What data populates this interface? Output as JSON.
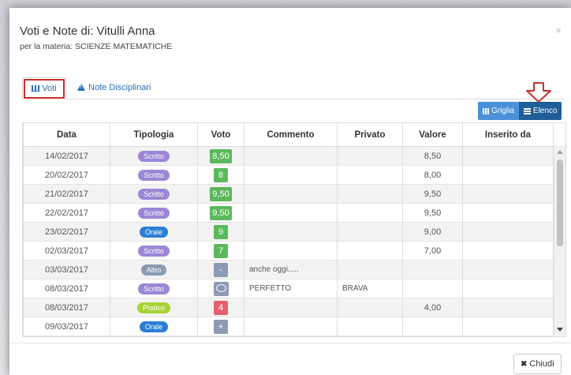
{
  "modal": {
    "title": "Voti e Note di: Vitulli Anna",
    "subtitle": "per la materia: SCIENZE MATEMATICHE",
    "close_symbol": "×"
  },
  "tabs": [
    {
      "label": "Voti",
      "icon": "bar-chart-icon",
      "active": true
    },
    {
      "label": "Note Disciplinari",
      "icon": "warning-icon",
      "active": false
    }
  ],
  "view_buttons": {
    "griglia": "Griglia",
    "elenco": "Elenco"
  },
  "table": {
    "headers": [
      "Data",
      "Tipologia",
      "Voto",
      "Commento",
      "Privato",
      "Valore",
      "Inserito da"
    ],
    "rows": [
      {
        "data": "14/02/2017",
        "tipologia": "Scritto",
        "voto": "8,50",
        "commento": "",
        "privato": "",
        "valore": "8,50",
        "inserito_da": ""
      },
      {
        "data": "20/02/2017",
        "tipologia": "Scritto",
        "voto": "8",
        "commento": "",
        "privato": "",
        "valore": "8,00",
        "inserito_da": ""
      },
      {
        "data": "21/02/2017",
        "tipologia": "Scritto",
        "voto": "9,50",
        "commento": "",
        "privato": "",
        "valore": "9,50",
        "inserito_da": ""
      },
      {
        "data": "22/02/2017",
        "tipologia": "Scritto",
        "voto": "9,50",
        "commento": "",
        "privato": "",
        "valore": "9,50",
        "inserito_da": ""
      },
      {
        "data": "23/02/2017",
        "tipologia": "Orale",
        "voto": "9",
        "commento": "",
        "privato": "",
        "valore": "9,00",
        "inserito_da": ""
      },
      {
        "data": "02/03/2017",
        "tipologia": "Scritto",
        "voto": "7",
        "commento": "",
        "privato": "",
        "valore": "7,00",
        "inserito_da": ""
      },
      {
        "data": "03/03/2017",
        "tipologia": "Altro",
        "voto": "-",
        "commento": "anche oggi.....",
        "privato": "",
        "valore": "",
        "inserito_da": ""
      },
      {
        "data": "08/03/2017",
        "tipologia": "Scritto",
        "voto": "",
        "commento": "PERFETTO",
        "privato": "BRAVA",
        "valore": "",
        "inserito_da": ""
      },
      {
        "data": "08/03/2017",
        "tipologia": "Pratico",
        "voto": "4",
        "commento": "",
        "privato": "",
        "valore": "4,00",
        "inserito_da": ""
      },
      {
        "data": "09/03/2017",
        "tipologia": "Orale",
        "voto": "+",
        "commento": "",
        "privato": "",
        "valore": "",
        "inserito_da": ""
      }
    ]
  },
  "footer": {
    "close_label": "Chiudi"
  },
  "colors": {
    "scritto": "#9b87d6",
    "orale": "#2a7fd4",
    "altro": "#8c9bb3",
    "pratico": "#a7d332",
    "vote_good": "#5cb85c",
    "vote_bad": "#e4606d",
    "vote_neutral": "#8c9bb3",
    "highlight": "#c9302c"
  }
}
